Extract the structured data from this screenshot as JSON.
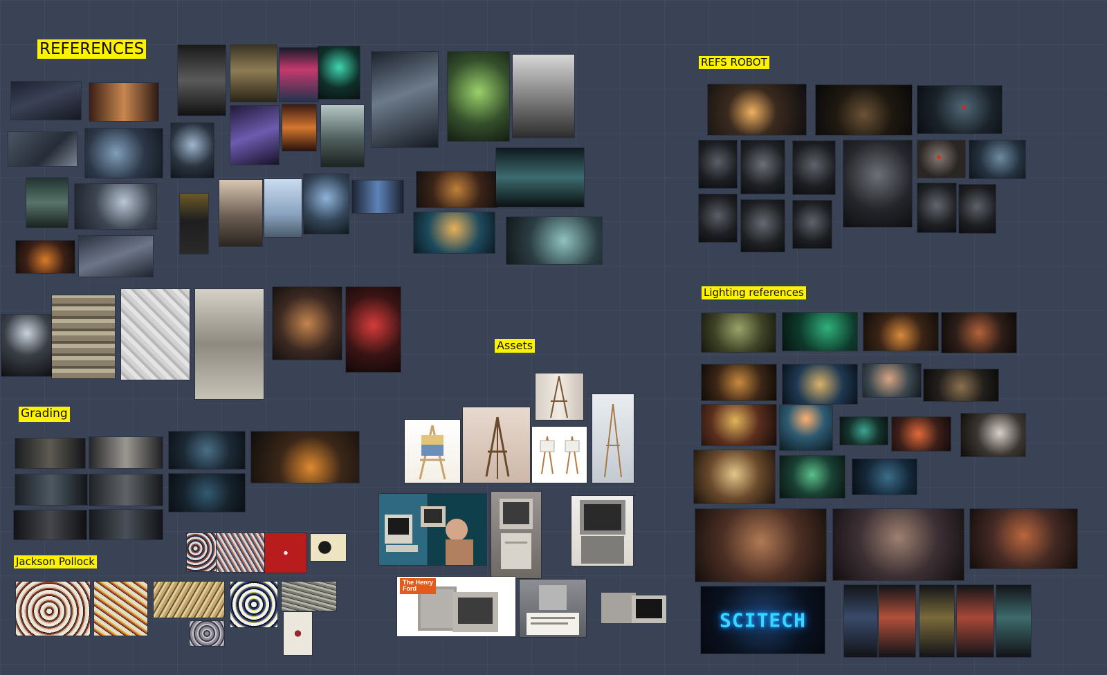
{
  "labels": {
    "references": "REFERENCES",
    "refs_robot": "REFS ROBOT",
    "lighting": "Lighting references",
    "assets": "Assets",
    "grading": "Grading",
    "jackson_pollock": "Jackson Pollock"
  },
  "monitor_caption": "SCITECH",
  "brand_tag": "The Henry\nFord",
  "palette": {
    "board_bg": "#3a4356",
    "label_bg": "#fff200",
    "screen_glow": "#39d6ff",
    "brand_orange": "#e25b1c"
  }
}
